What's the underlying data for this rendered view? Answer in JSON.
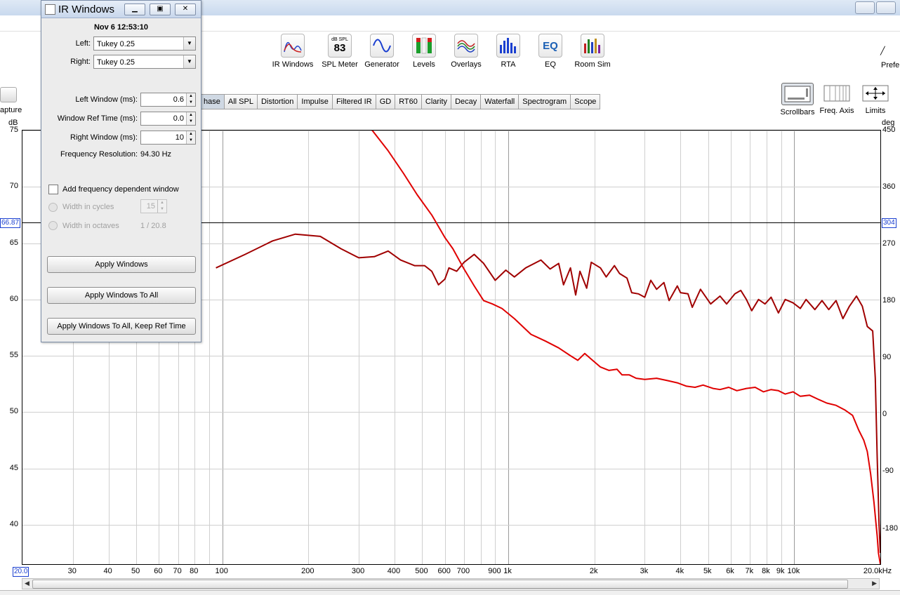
{
  "dialog": {
    "title": "IR Windows",
    "timestamp": "Nov 6 12:53:10",
    "left_label": "Left:",
    "left_value": "Tukey 0.25",
    "right_label": "Right:",
    "right_value": "Tukey 0.25",
    "left_window_label": "Left Window (ms):",
    "left_window_value": "0.6",
    "ref_time_label": "Window Ref Time (ms):",
    "ref_time_value": "0.0",
    "right_window_label": "Right Window (ms):",
    "right_window_value": "10",
    "freq_res_label": "Frequency Resolution:",
    "freq_res_value": "94.30 Hz",
    "fdw_label": "Add frequency dependent window",
    "cycles_label": "Width in cycles",
    "cycles_value": "15",
    "octaves_label": "Width in octaves",
    "octaves_value": "1 / 20.8",
    "btn_apply": "Apply Windows",
    "btn_apply_all": "Apply Windows To All",
    "btn_apply_all_keep": "Apply Windows To All, Keep Ref Time"
  },
  "toolbar": [
    {
      "label": "IR Windows",
      "icon": "ir-windows-icon"
    },
    {
      "label": "SPL Meter",
      "icon": "spl-meter-icon",
      "top": "dB SPL",
      "value": "83"
    },
    {
      "label": "Generator",
      "icon": "generator-icon"
    },
    {
      "label": "Levels",
      "icon": "levels-icon"
    },
    {
      "label": "Overlays",
      "icon": "overlays-icon"
    },
    {
      "label": "RTA",
      "icon": "rta-icon"
    },
    {
      "label": "EQ",
      "icon": "eq-icon",
      "text": "EQ"
    },
    {
      "label": "Room Sim",
      "icon": "room-sim-icon"
    }
  ],
  "prefs_label": "Prefe",
  "capture_label": "apture",
  "tabs": [
    "hase",
    "All SPL",
    "Distortion",
    "Impulse",
    "Filtered IR",
    "GD",
    "RT60",
    "Clarity",
    "Decay",
    "Waterfall",
    "Spectrogram",
    "Scope"
  ],
  "right_tools": [
    {
      "label": "Scrollbars",
      "icon": "scrollbars-icon"
    },
    {
      "label": "Freq. Axis",
      "icon": "freq-axis-icon"
    },
    {
      "label": "Limits",
      "icon": "limits-icon"
    }
  ],
  "chart_data": {
    "type": "line",
    "x_scale": "log",
    "xlim": [
      20,
      20000
    ],
    "ylim_left": [
      36.5,
      75
    ],
    "ylim_right": [
      -236,
      450
    ],
    "left_unit": "dB",
    "right_unit": "deg",
    "left_ticks": [
      "75",
      "70",
      "65",
      "60",
      "55",
      "50",
      "45",
      "40"
    ],
    "left_tick_values": [
      75,
      70,
      65,
      60,
      55,
      50,
      45,
      40
    ],
    "right_ticks": [
      "450",
      "360",
      "270",
      "180",
      "90",
      "0",
      "-90",
      "-180"
    ],
    "right_tick_values": [
      450,
      360,
      270,
      180,
      90,
      0,
      -90,
      -180
    ],
    "x_ticks": [
      {
        "v": 20,
        "t": "20.0"
      },
      {
        "v": 30,
        "t": "30"
      },
      {
        "v": 40,
        "t": "40"
      },
      {
        "v": 50,
        "t": "50"
      },
      {
        "v": 60,
        "t": "60"
      },
      {
        "v": 70,
        "t": "70"
      },
      {
        "v": 80,
        "t": "80"
      },
      {
        "v": 100,
        "t": "100"
      },
      {
        "v": 200,
        "t": "200"
      },
      {
        "v": 300,
        "t": "300"
      },
      {
        "v": 400,
        "t": "400"
      },
      {
        "v": 500,
        "t": "500"
      },
      {
        "v": 600,
        "t": "600"
      },
      {
        "v": 700,
        "t": "700"
      },
      {
        "v": 900,
        "t": "900"
      },
      {
        "v": 1000,
        "t": "1k"
      },
      {
        "v": 2000,
        "t": "2k"
      },
      {
        "v": 3000,
        "t": "3k"
      },
      {
        "v": 4000,
        "t": "4k"
      },
      {
        "v": 5000,
        "t": "5k"
      },
      {
        "v": 6000,
        "t": "6k"
      },
      {
        "v": 7000,
        "t": "7k"
      },
      {
        "v": 8000,
        "t": "8k"
      },
      {
        "v": 9000,
        "t": "9k"
      },
      {
        "v": 10000,
        "t": "10k"
      },
      {
        "v": 20000,
        "t": "20.0kHz"
      }
    ],
    "cursor_left": "66.87",
    "cursor_right": "304",
    "cursor_value": 66.87,
    "series": [
      {
        "color": "#a00000",
        "points": [
          [
            95,
            62.8
          ],
          [
            120,
            64
          ],
          [
            150,
            65.2
          ],
          [
            180,
            65.8
          ],
          [
            220,
            65.6
          ],
          [
            260,
            64.5
          ],
          [
            300,
            63.7
          ],
          [
            340,
            63.8
          ],
          [
            380,
            64.3
          ],
          [
            420,
            63.5
          ],
          [
            470,
            63
          ],
          [
            510,
            63
          ],
          [
            540,
            62.5
          ],
          [
            570,
            61.3
          ],
          [
            600,
            61.8
          ],
          [
            620,
            62.8
          ],
          [
            660,
            62.5
          ],
          [
            700,
            63.3
          ],
          [
            760,
            64
          ],
          [
            820,
            63.2
          ],
          [
            900,
            61.7
          ],
          [
            980,
            62.6
          ],
          [
            1050,
            62
          ],
          [
            1150,
            62.8
          ],
          [
            1300,
            63.5
          ],
          [
            1400,
            62.7
          ],
          [
            1500,
            63.2
          ],
          [
            1560,
            61.3
          ],
          [
            1650,
            62.8
          ],
          [
            1720,
            60.4
          ],
          [
            1780,
            62.5
          ],
          [
            1880,
            61
          ],
          [
            1950,
            63.3
          ],
          [
            2100,
            62.8
          ],
          [
            2200,
            62
          ],
          [
            2350,
            63
          ],
          [
            2450,
            62.3
          ],
          [
            2600,
            61.9
          ],
          [
            2700,
            60.6
          ],
          [
            2850,
            60.5
          ],
          [
            3000,
            60.2
          ],
          [
            3150,
            61.7
          ],
          [
            3300,
            60.9
          ],
          [
            3500,
            61.5
          ],
          [
            3650,
            59.9
          ],
          [
            3900,
            61.2
          ],
          [
            4000,
            60.6
          ],
          [
            4250,
            60.5
          ],
          [
            4400,
            59.3
          ],
          [
            4700,
            60.9
          ],
          [
            5100,
            59.6
          ],
          [
            5500,
            60.3
          ],
          [
            5800,
            59.6
          ],
          [
            6200,
            60.5
          ],
          [
            6500,
            60.8
          ],
          [
            6800,
            60
          ],
          [
            7100,
            59
          ],
          [
            7500,
            60
          ],
          [
            7900,
            59.6
          ],
          [
            8300,
            60.2
          ],
          [
            8800,
            58.8
          ],
          [
            9300,
            60
          ],
          [
            9900,
            59.7
          ],
          [
            10500,
            59.2
          ],
          [
            11000,
            60
          ],
          [
            11800,
            59.1
          ],
          [
            12500,
            59.9
          ],
          [
            13200,
            59.1
          ],
          [
            14000,
            59.9
          ],
          [
            14800,
            58.3
          ],
          [
            15600,
            59.4
          ],
          [
            16500,
            60.3
          ],
          [
            17300,
            59.4
          ],
          [
            18000,
            57.6
          ],
          [
            18800,
            57.2
          ],
          [
            19200,
            53
          ],
          [
            19500,
            46
          ],
          [
            19800,
            40
          ],
          [
            20000,
            37.5
          ]
        ]
      },
      {
        "color": "#e00000",
        "points": [
          [
            330,
            75.2
          ],
          [
            380,
            73.2
          ],
          [
            430,
            71.2
          ],
          [
            480,
            69.3
          ],
          [
            540,
            67.5
          ],
          [
            600,
            65.5
          ],
          [
            640,
            64.5
          ],
          [
            700,
            62.7
          ],
          [
            760,
            61.2
          ],
          [
            820,
            59.9
          ],
          [
            880,
            59.6
          ],
          [
            950,
            59.2
          ],
          [
            1050,
            58.3
          ],
          [
            1200,
            56.9
          ],
          [
            1350,
            56.3
          ],
          [
            1500,
            55.7
          ],
          [
            1650,
            55
          ],
          [
            1750,
            54.6
          ],
          [
            1850,
            55.2
          ],
          [
            1950,
            54.7
          ],
          [
            2100,
            54
          ],
          [
            2250,
            53.7
          ],
          [
            2400,
            53.8
          ],
          [
            2500,
            53.3
          ],
          [
            2650,
            53.3
          ],
          [
            2800,
            53
          ],
          [
            3000,
            52.9
          ],
          [
            3300,
            53
          ],
          [
            3600,
            52.8
          ],
          [
            3900,
            52.6
          ],
          [
            4200,
            52.3
          ],
          [
            4500,
            52.2
          ],
          [
            4800,
            52.4
          ],
          [
            5200,
            52.1
          ],
          [
            5500,
            52
          ],
          [
            5900,
            52.2
          ],
          [
            6300,
            51.9
          ],
          [
            6800,
            52.1
          ],
          [
            7300,
            52.2
          ],
          [
            7800,
            51.8
          ],
          [
            8300,
            52
          ],
          [
            8800,
            51.9
          ],
          [
            9300,
            51.6
          ],
          [
            9900,
            51.8
          ],
          [
            10500,
            51.4
          ],
          [
            11300,
            51.5
          ],
          [
            12200,
            51.1
          ],
          [
            13000,
            50.8
          ],
          [
            14000,
            50.6
          ],
          [
            15000,
            50.2
          ],
          [
            16000,
            49.7
          ],
          [
            16800,
            48.4
          ],
          [
            17500,
            47.5
          ],
          [
            18000,
            46.5
          ],
          [
            18500,
            44.5
          ],
          [
            19000,
            42
          ],
          [
            19500,
            39
          ],
          [
            19700,
            37.5
          ],
          [
            20000,
            36.5
          ]
        ]
      }
    ]
  }
}
